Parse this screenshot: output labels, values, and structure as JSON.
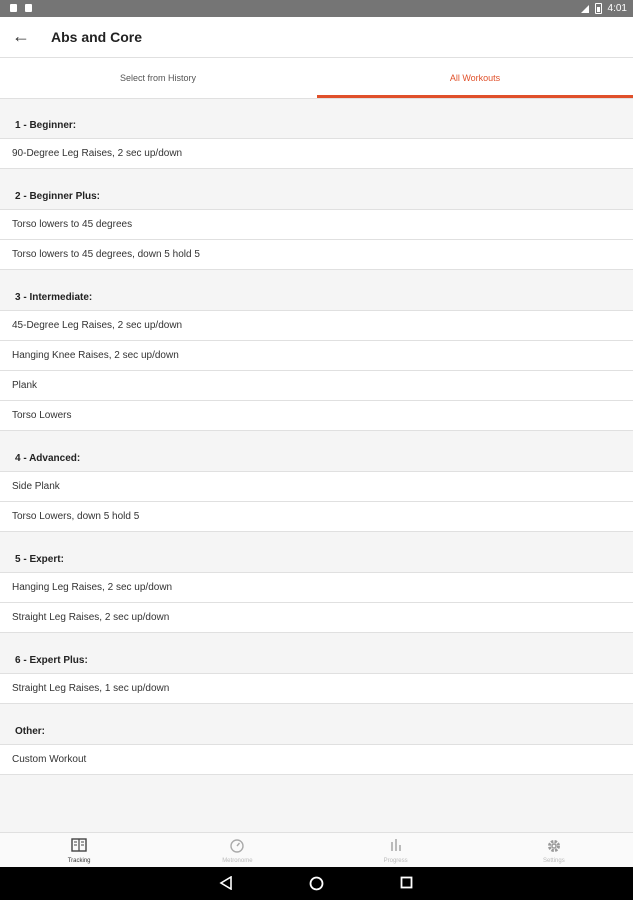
{
  "status_bar": {
    "time": "4:01"
  },
  "app_bar": {
    "title": "Abs and Core"
  },
  "tabs": [
    {
      "label": "Select from History"
    },
    {
      "label": "All Workouts"
    }
  ],
  "sections": [
    {
      "header": "1 - Beginner:",
      "items": [
        "90-Degree Leg Raises, 2 sec up/down"
      ]
    },
    {
      "header": "2 - Beginner Plus:",
      "items": [
        "Torso lowers to 45 degrees",
        "Torso lowers to 45 degrees, down 5 hold 5"
      ]
    },
    {
      "header": "3 - Intermediate:",
      "items": [
        "45-Degree Leg Raises, 2 sec up/down",
        "Hanging Knee Raises, 2 sec up/down",
        "Plank",
        "Torso Lowers"
      ]
    },
    {
      "header": "4 - Advanced:",
      "items": [
        "Side Plank",
        "Torso Lowers, down 5 hold 5"
      ]
    },
    {
      "header": "5 - Expert:",
      "items": [
        "Hanging Leg Raises, 2 sec up/down",
        "Straight Leg Raises, 2 sec up/down"
      ]
    },
    {
      "header": "6 - Expert Plus:",
      "items": [
        "Straight Leg Raises, 1 sec up/down"
      ]
    },
    {
      "header": "Other:",
      "items": [
        "Custom Workout"
      ]
    }
  ],
  "bottom_nav": [
    {
      "label": "Tracking",
      "icon": "book-icon"
    },
    {
      "label": "Metronome",
      "icon": "timer-icon"
    },
    {
      "label": "Progress",
      "icon": "bar-chart-icon"
    },
    {
      "label": "Settings",
      "icon": "gear-icon"
    }
  ],
  "colors": {
    "accent": "#e0502a"
  }
}
